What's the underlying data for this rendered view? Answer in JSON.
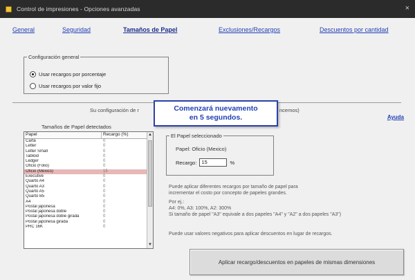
{
  "window": {
    "title": "Control de impresiones - Opciones avanzadas",
    "close_glyph": "×"
  },
  "tabs": [
    {
      "label": "General"
    },
    {
      "label": "Seguridad"
    },
    {
      "label": "Tamaños de Papel"
    },
    {
      "label": "Exclusiones/Recargos"
    },
    {
      "label": "Descuentos por cantidad"
    }
  ],
  "general_config": {
    "legend": "Configuración general",
    "options": [
      {
        "label": "Usar recargos por porcentaje",
        "checked": true
      },
      {
        "label": "Usar recargos por valor fijo",
        "checked": false
      }
    ]
  },
  "info_line": "Su configuración de r",
  "info_line_end": "ncemos)",
  "help_link": "Ayuda",
  "toast": {
    "line1": "Comenzará nuevamento",
    "line2": "en 5 segundos."
  },
  "paper_list": {
    "caption": "Tamaños de Papel detectados",
    "columns": [
      "Papel",
      "Recargo (%)"
    ],
    "rows": [
      {
        "name": "Carta",
        "value": "0"
      },
      {
        "name": "Letter",
        "value": "0"
      },
      {
        "name": "Letter Small",
        "value": "0"
      },
      {
        "name": "Tabloid",
        "value": "0"
      },
      {
        "name": "Ledger",
        "value": "0"
      },
      {
        "name": "Oficio (Folio)",
        "value": "0"
      },
      {
        "name": "Oficio (Mexico)",
        "value": "15"
      },
      {
        "name": "Executive",
        "value": "0"
      },
      {
        "name": "Quarto A4",
        "value": "0"
      },
      {
        "name": "Quarto A3",
        "value": "0"
      },
      {
        "name": "Quarto A5",
        "value": "0"
      },
      {
        "name": "Quarto B5",
        "value": "0"
      },
      {
        "name": "A4",
        "value": "0"
      },
      {
        "name": "Postal japonesa",
        "value": "0"
      },
      {
        "name": "Postal japonesa doble",
        "value": "0"
      },
      {
        "name": "Postal japonesa doble girada",
        "value": "0"
      },
      {
        "name": "Postal japonesa girada",
        "value": "0"
      },
      {
        "name": "PRC 16K",
        "value": "0"
      }
    ]
  },
  "selected_paper": {
    "legend": "El Papel seleccionado",
    "name": "Papel: Oficio (Mexico)",
    "recargo_label": "Recargo:",
    "recargo_value": "15",
    "unit": "%"
  },
  "help_text": [
    "Puede aplicar diferentes recargos por tamaño de papel para",
    "incrementar el costo por concepto de papeles grandes.",
    "Por ej.:",
    "A4: 0%,   A3: 100%,   A2: 300%",
    "Si tamaño de papel \"A3\" equivale a dos papeles \"A4\" y \"A2\" a dos papeles \"A3\")",
    "Puede usar valores negativos para aplicar descuentos en lugar de recargos."
  ],
  "apply_button": "Aplicar recargo/descuentos en papeles de mismas dimensiones"
}
